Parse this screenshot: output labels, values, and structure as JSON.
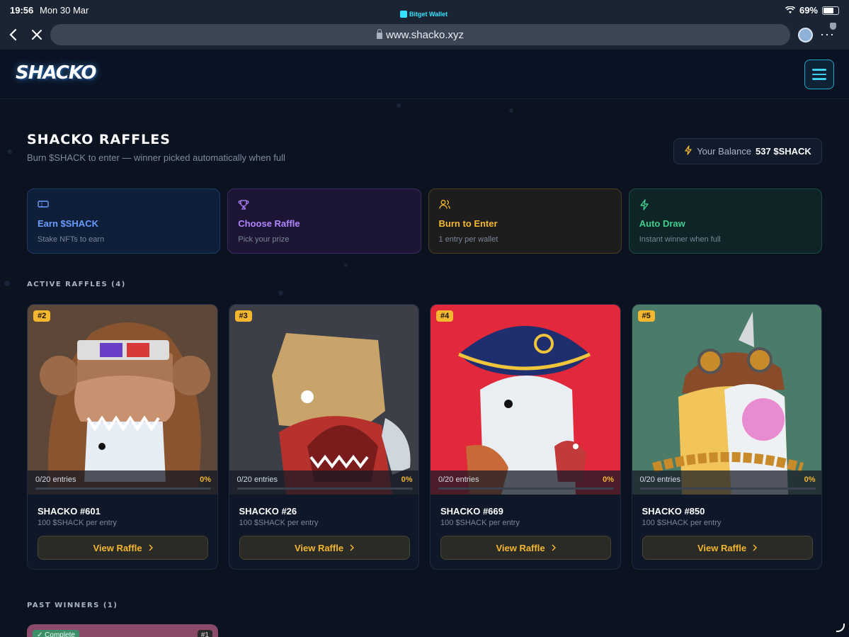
{
  "status_bar": {
    "time": "19:56",
    "date": "Mon 30 Mar",
    "wallet_app": "Bitget Wallet",
    "battery": "69%",
    "battery_level": 0.69
  },
  "browser": {
    "url": "www.shacko.xyz"
  },
  "header": {
    "logo": "SHACKO",
    "menu_icon": "hamburger-icon"
  },
  "page": {
    "title": "SHACKO RAFFLES",
    "subtitle": "Burn $SHACK to enter — winner picked automatically when full",
    "balance_label": "Your Balance",
    "balance_value": "537 $SHACK"
  },
  "steps": [
    {
      "icon": "ticket-icon",
      "title": "Earn $SHACK",
      "desc": "Stake NFTs to earn",
      "color": "#6a9cff"
    },
    {
      "icon": "trophy-icon",
      "title": "Choose Raffle",
      "desc": "Pick your prize",
      "color": "#b184ff"
    },
    {
      "icon": "users-icon",
      "title": "Burn to Enter",
      "desc": "1 entry per wallet",
      "color": "#f4b72f"
    },
    {
      "icon": "bolt-icon",
      "title": "Auto Draw",
      "desc": "Instant winner when full",
      "color": "#3ccf8e"
    }
  ],
  "active_label": "ACTIVE RAFFLES (4)",
  "raffles": [
    {
      "badge": "#2",
      "entries": "0/20 entries",
      "pct": "0%",
      "progress": 0,
      "name": "SHACKO #601",
      "price": "100 $SHACK per entry",
      "button": "View Raffle",
      "bg": "#6b4a3a"
    },
    {
      "badge": "#3",
      "entries": "0/20 entries",
      "pct": "0%",
      "progress": 0,
      "name": "SHACKO #26",
      "price": "100 $SHACK per entry",
      "button": "View Raffle",
      "bg": "#3a3d44"
    },
    {
      "badge": "#4",
      "entries": "0/20 entries",
      "pct": "0%",
      "progress": 0,
      "name": "SHACKO #669",
      "price": "100 $SHACK per entry",
      "button": "View Raffle",
      "bg": "#e3283c"
    },
    {
      "badge": "#5",
      "entries": "0/20 entries",
      "pct": "0%",
      "progress": 0,
      "name": "SHACKO #850",
      "price": "100 $SHACK per entry",
      "button": "View Raffle",
      "bg": "#4a7a68"
    }
  ],
  "past_label": "PAST WINNERS (1)",
  "past_winner": {
    "status": "✓ Complete",
    "badge": "#1"
  }
}
